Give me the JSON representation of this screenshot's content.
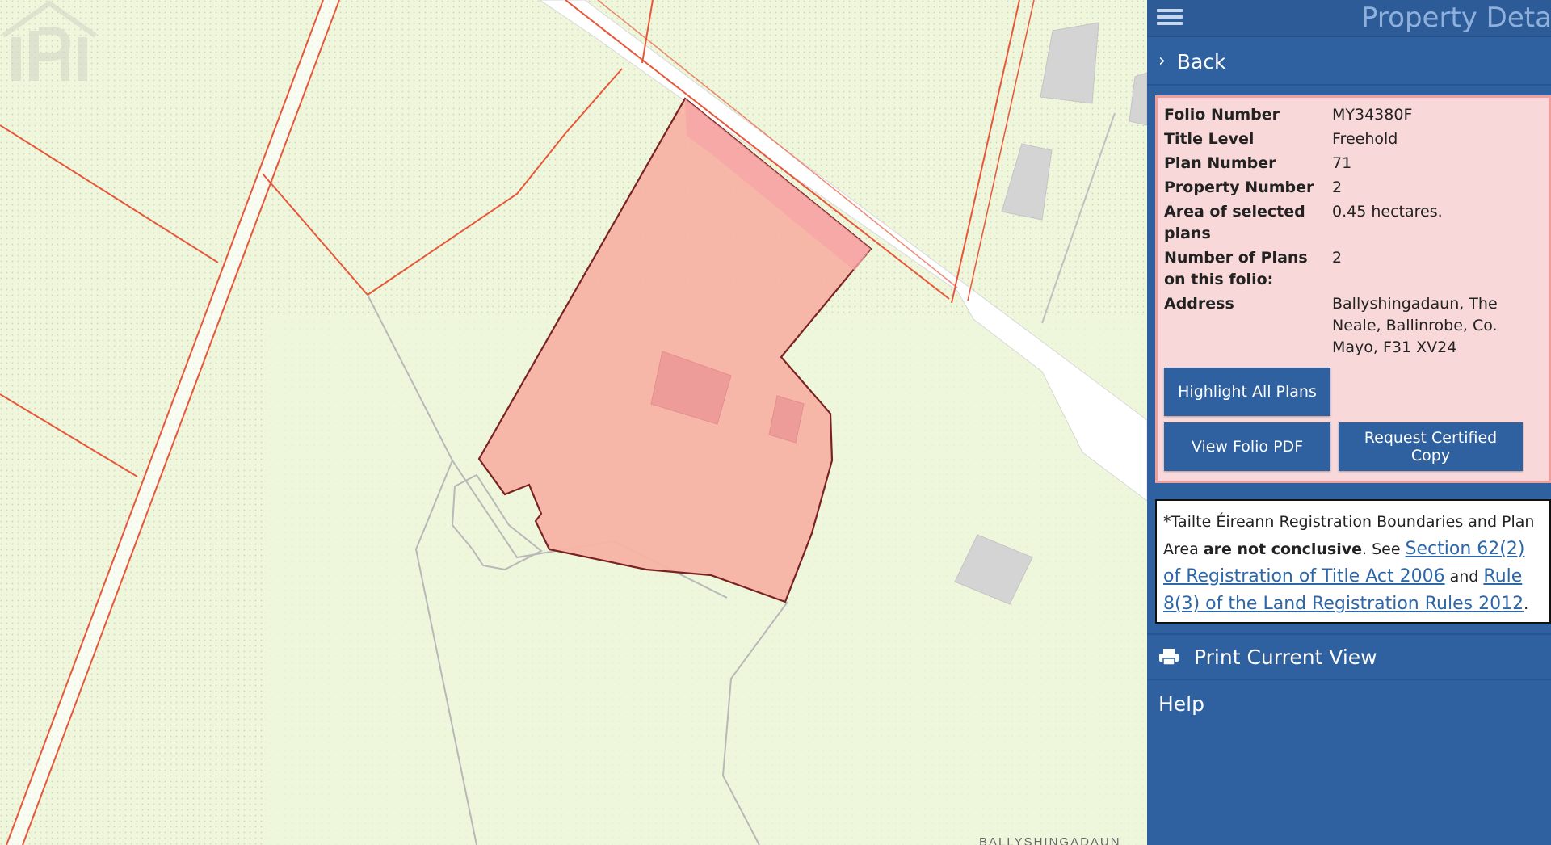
{
  "map": {
    "place_label": "BALLYSHINGADAUN"
  },
  "panel": {
    "title": "Property Details",
    "back_label": "Back",
    "details": [
      {
        "key": "Folio Number",
        "value": "MY34380F"
      },
      {
        "key": "Title Level",
        "value": "Freehold"
      },
      {
        "key": "Plan Number",
        "value": "71"
      },
      {
        "key": "Property Number",
        "value": "2"
      },
      {
        "key": "Area of selected plans",
        "value": "0.45 hectares."
      },
      {
        "key": "Number of Plans on this folio:",
        "value": "2"
      },
      {
        "key": "Address",
        "value": "Ballyshingadaun, The Neale, Ballinrobe, Co. Mayo, F31 XV24"
      }
    ],
    "buttons": {
      "highlight": "Highlight All Plans",
      "view_pdf": "View Folio PDF",
      "request_copy": "Request Certified Copy"
    },
    "notice": {
      "lead": "*Tailte Éireann Registration Boundaries and Plan Area ",
      "bold": "are not conclusive",
      "see": ". See ",
      "link1": "Section 62(2) of Registration of Title Act 2006",
      "and": " and ",
      "link2": "Rule 8(3) of the Land Registration Rules 2012",
      "end": "."
    },
    "nav": {
      "print": "Print Current View",
      "help": "Help"
    }
  },
  "colors": {
    "panel_bg": "#2f61a0",
    "details_bg": "#f8d8d8",
    "parcel_fill": "#f5b3a4",
    "parcel_edge": "#7a2222"
  }
}
